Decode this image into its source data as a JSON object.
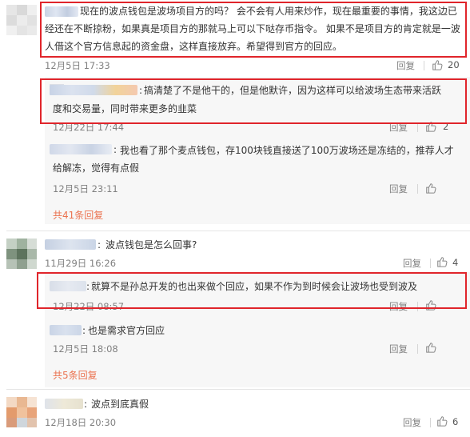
{
  "comments": [
    {
      "text_lines": [
        "现在的波点钱包是波场项目方的吗？ 会不会有人用来炒作，现在最重要的事情，我这边已",
        "经还在不断掠粉，如果真是项目方的那就马上可以下哒存币指令。 如果不是项目方的肯定就是一波",
        "人借这个官方信息起的资金盘，这样直接放弃。希望得到官方的回应。"
      ],
      "time": "12月5日 17:33",
      "reply_label": "回复",
      "likes": "20",
      "replies": [
        {
          "text_lines": [
            "搞清楚了不是他干的，但是他默许，因为这样可以给波场生态带来活跃",
            "度和交易量，同时带来更多的韭菜"
          ],
          "time": "12月22日 17:44",
          "reply_label": "回复",
          "likes": "2"
        },
        {
          "text_lines": [
            "我也看了那个麦点钱包，存100块钱直接送了100万波场还是冻结的，推荐人才",
            "给解冻，觉得有点假"
          ],
          "time": "12月5日 23:11",
          "reply_label": "回复",
          "likes": ""
        }
      ],
      "more_replies": "共41条回复"
    },
    {
      "text_lines": [
        "波点钱包是怎么回事?"
      ],
      "time": "11月29日 16:26",
      "reply_label": "回复",
      "likes": "4",
      "replies": [
        {
          "text_lines": [
            "就算不是孙总开发的也出来做个回应，如果不作为到时候会让波场也受到波及"
          ],
          "time": "12月22日 08:57",
          "reply_label": "回复",
          "likes": ""
        },
        {
          "text_lines": [
            "也是需求官方回应"
          ],
          "time": "12月5日 18:08",
          "reply_label": "回复",
          "likes": ""
        }
      ],
      "more_replies": "共5条回复"
    },
    {
      "text_lines": [
        "波点到底真假"
      ],
      "time": "12月18日 20:30",
      "reply_label": "回复",
      "likes": "6",
      "replies": []
    }
  ],
  "icons": {
    "like": "thumbs-up-icon"
  },
  "colors": {
    "highlight": "#e0252b",
    "more_link": "#eb7350",
    "meta": "#808080"
  }
}
